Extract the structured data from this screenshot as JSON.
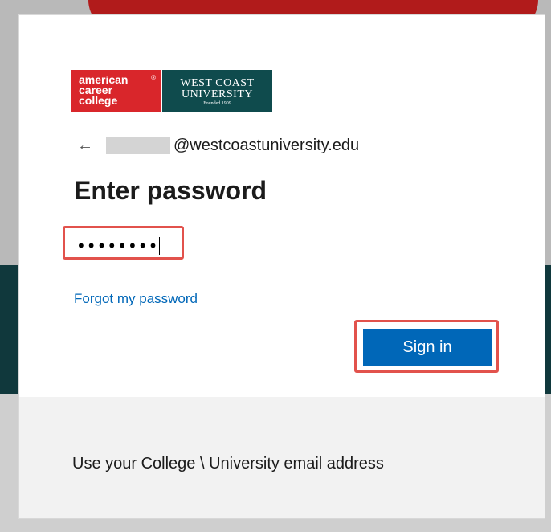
{
  "logo": {
    "acc_lines": [
      "american",
      "career",
      "college"
    ],
    "acc_mark": "®",
    "wcu_line1": "WEST COAST",
    "wcu_line2": "UNIVERSITY",
    "wcu_line3": "Founded 1909"
  },
  "identity": {
    "back_icon": "←",
    "email_domain": "@westcoastuniversity.edu"
  },
  "form": {
    "title": "Enter password",
    "password_value": "••••••••",
    "forgot_link": "Forgot my password",
    "signin_label": "Sign in"
  },
  "footer": {
    "text": "Use your College \\ University email address"
  },
  "colors": {
    "accent": "#0067b8",
    "highlight": "#e2524c"
  }
}
